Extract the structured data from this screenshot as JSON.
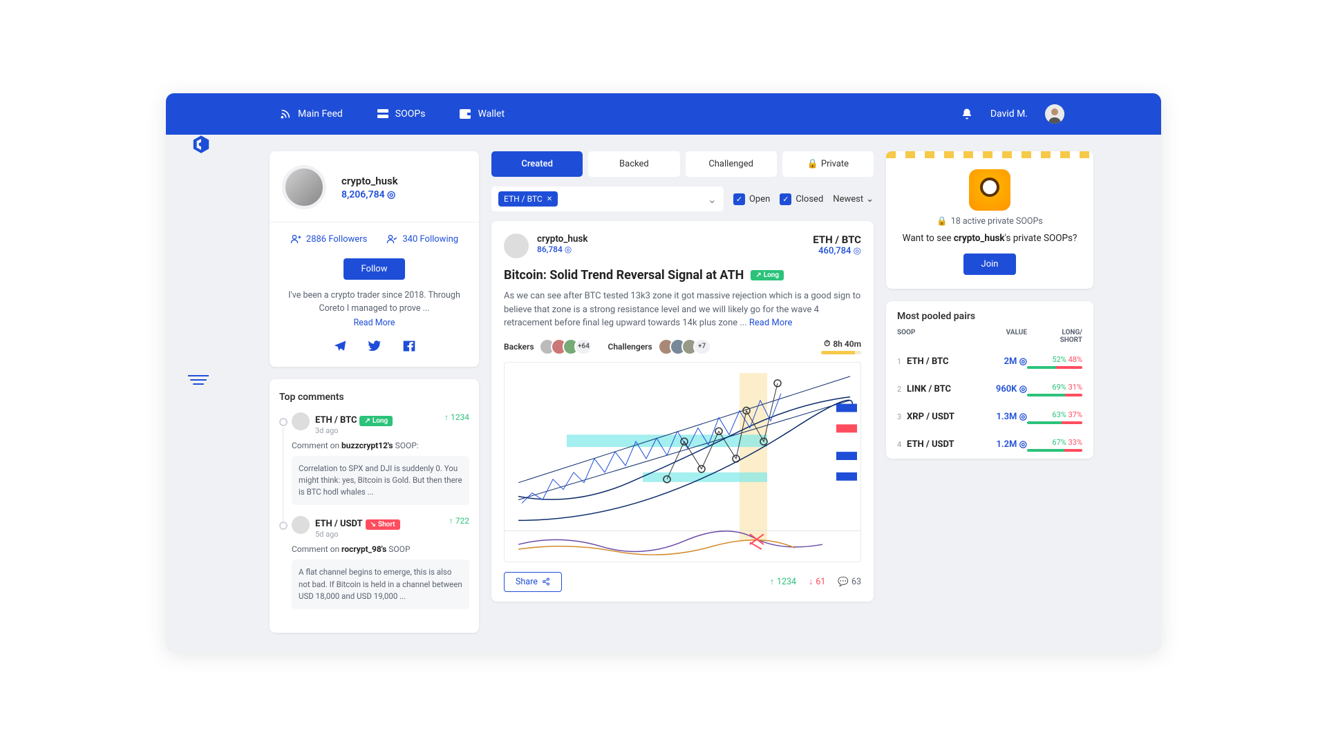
{
  "nav": {
    "feed": "Main Feed",
    "soops": "SOOPs",
    "wallet": "Wallet"
  },
  "topbar": {
    "user": "David M."
  },
  "profile": {
    "username": "crypto_husk",
    "balance": "8,206,784",
    "followers": "2886 Followers",
    "following": "340 Following",
    "follow_btn": "Follow",
    "bio": "I've been a crypto trader since 2018. Through Coreto I managed to prove ...",
    "read_more": "Read More"
  },
  "top_comments": {
    "title": "Top comments",
    "items": [
      {
        "pair": "ETH / BTC",
        "age": "3d ago",
        "dir": "Long",
        "votes": "1234",
        "ref_pre": "Comment on ",
        "ref_user": "buzzcrypt12's",
        "ref_suf": " SOOP:",
        "body": "Correlation to SPX and DJI is suddenly 0. You might think: yes, Bitcoin is Gold. But then there is BTC hodl whales ..."
      },
      {
        "pair": "ETH / USDT",
        "age": "5d ago",
        "dir": "Short",
        "votes": "722",
        "ref_pre": "Comment on ",
        "ref_user": "rocrypt_98's",
        "ref_suf": " SOOP",
        "body": "A flat channel begins to emerge, this is also not bad. If Bitcoin is held in a channel between USD 18,000 and USD 19,000 ..."
      }
    ]
  },
  "tabs": {
    "created": "Created",
    "backed": "Backed",
    "challenged": "Challenged",
    "private": "Private"
  },
  "filters": {
    "chip": "ETH / BTC",
    "open": "Open",
    "closed": "Closed",
    "sort": "Newest"
  },
  "post": {
    "user": "crypto_husk",
    "bal": "86,784",
    "pair": "ETH / BTC",
    "amount": "460,784",
    "title": "Bitcoin: Solid Trend Reversal Signal at ATH",
    "dir": "Long",
    "desc": "As we can see after BTC tested 13k3 zone it got massive rejection which is a good sign to believe that zone is a strong resistance level and we will likely go for the wave 4 retracement before final leg upward towards 14k plus zone ...  ",
    "read_more": "Read More",
    "backers": "Backers",
    "backers_more": "+64",
    "challengers": "Challengers",
    "challengers_more": "+7",
    "timer": "8h 40m",
    "share": "Share",
    "up": "1234",
    "down": "61",
    "comments": "63"
  },
  "private_panel": {
    "count": "18 active private SOOPs",
    "text_pre": "Want to see ",
    "text_user": "crypto_husk",
    "text_suf": "'s private SOOPs?",
    "join": "Join"
  },
  "pool": {
    "title": "Most pooled pairs",
    "head": {
      "soop": "SOOP",
      "value": "VALUE",
      "ls": "LONG/\nSHORT"
    },
    "rows": [
      {
        "idx": "1",
        "pair": "ETH / BTC",
        "val": "2M",
        "l": "52%",
        "s": "48%",
        "lp": 52
      },
      {
        "idx": "2",
        "pair": "LINK / BTC",
        "val": "960K",
        "l": "69%",
        "s": "31%",
        "lp": 69
      },
      {
        "idx": "3",
        "pair": "XRP / USDT",
        "val": "1.3M",
        "l": "63%",
        "s": "37%",
        "lp": 63
      },
      {
        "idx": "4",
        "pair": "ETH / USDT",
        "val": "1.2M",
        "l": "67%",
        "s": "33%",
        "lp": 67
      }
    ]
  }
}
